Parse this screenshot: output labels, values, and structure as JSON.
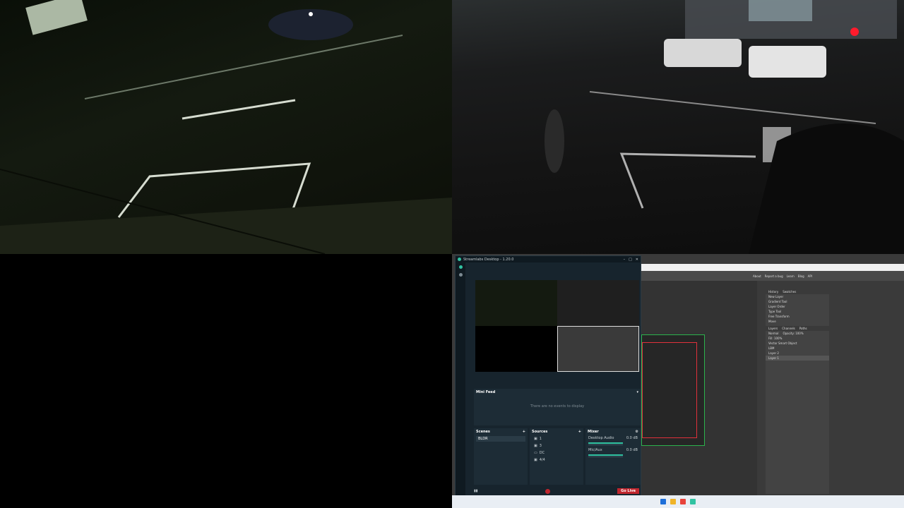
{
  "cameras": {
    "cam1_label": "",
    "cam2_label": ""
  },
  "streamlabs": {
    "title": "Streamlabs Desktop - 1.20.0",
    "mini_feed": {
      "title": "Mini Feed",
      "empty_text": "There are no events to display"
    },
    "scenes": {
      "title": "Scenes",
      "items": [
        "BLDR"
      ]
    },
    "sources": {
      "title": "Sources",
      "items": [
        {
          "label": "1",
          "icon": "camera-icon"
        },
        {
          "label": "3",
          "icon": "camera-icon"
        },
        {
          "label": "DC",
          "icon": "monitor-icon"
        },
        {
          "label": "4/4",
          "icon": "camera-icon"
        }
      ]
    },
    "mixer": {
      "title": "Mixer",
      "channels": [
        {
          "name": "Desktop Audio",
          "level": "0.0 dB"
        },
        {
          "name": "Mic/Aux",
          "level": "0.0 dB"
        }
      ]
    },
    "go_live_label": "Go Live"
  },
  "editor": {
    "menu": [
      "About",
      "Report a bug",
      "Learn",
      "Blog",
      "API"
    ],
    "history_tab": "History",
    "swatches_tab": "Swatches",
    "history_items": [
      "New Layer",
      "Gradient Tool",
      "Layer Order",
      "Type Tool",
      "Free Transform",
      "Move"
    ],
    "layer_tabs": [
      "Layers",
      "Channels",
      "Paths"
    ],
    "blend_mode": "Normal",
    "opacity": "Opacity: 100%",
    "fill": "Fill: 100%",
    "layers": [
      "Vector Smart Object",
      "LBM",
      "Layer 2",
      "Layer 1"
    ]
  },
  "colors": {
    "accent": "#31c3a2",
    "record": "#c0262e",
    "doc_border_outer": "#2bb24c",
    "doc_border_inner": "#e0313b"
  }
}
